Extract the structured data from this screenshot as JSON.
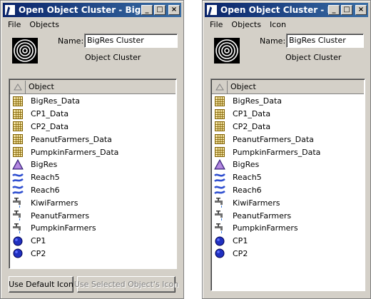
{
  "windows": [
    {
      "title": "Open Object Cluster - BigRes Cluster",
      "title_visible": "Open Object Cluster - BigRes ...",
      "menu": [
        "File",
        "Objects"
      ],
      "name_label": "Name:",
      "name_value": "BigRes Cluster",
      "type_label": "Object Cluster",
      "column_header": "Object",
      "buttons": [
        "Use Default Icon",
        "Use Selected Object's Icon"
      ]
    },
    {
      "title": "Open Object Cluster - BigRes Cluster",
      "title_visible": "Open Object Cluster - Big...",
      "menu": [
        "File",
        "Objects",
        "Icon"
      ],
      "name_label": "Name:",
      "name_value": "BigRes Cluster",
      "type_label": "Object Cluster",
      "column_header": "Object",
      "buttons": []
    }
  ],
  "objects": [
    {
      "name": "BigRes_Data",
      "icon": "data-grid-icon"
    },
    {
      "name": "CP1_Data",
      "icon": "data-grid-icon"
    },
    {
      "name": "CP2_Data",
      "icon": "data-grid-icon"
    },
    {
      "name": "PeanutFarmers_Data",
      "icon": "data-grid-icon"
    },
    {
      "name": "PumpkinFarmers_Data",
      "icon": "data-grid-icon"
    },
    {
      "name": "BigRes",
      "icon": "reservoir-triangle-icon"
    },
    {
      "name": "Reach5",
      "icon": "reach-icon"
    },
    {
      "name": "Reach6",
      "icon": "reach-icon"
    },
    {
      "name": "KiwiFarmers",
      "icon": "water-user-faucet-icon"
    },
    {
      "name": "PeanutFarmers",
      "icon": "water-user-faucet-icon"
    },
    {
      "name": "PumpkinFarmers",
      "icon": "water-user-faucet-icon"
    },
    {
      "name": "CP1",
      "icon": "control-point-icon"
    },
    {
      "name": "CP2",
      "icon": "control-point-icon"
    }
  ],
  "colors": {
    "titlebar_start": "#0a246a",
    "titlebar_end": "#3a6ea5",
    "window_bg": "#d4d0c8"
  }
}
